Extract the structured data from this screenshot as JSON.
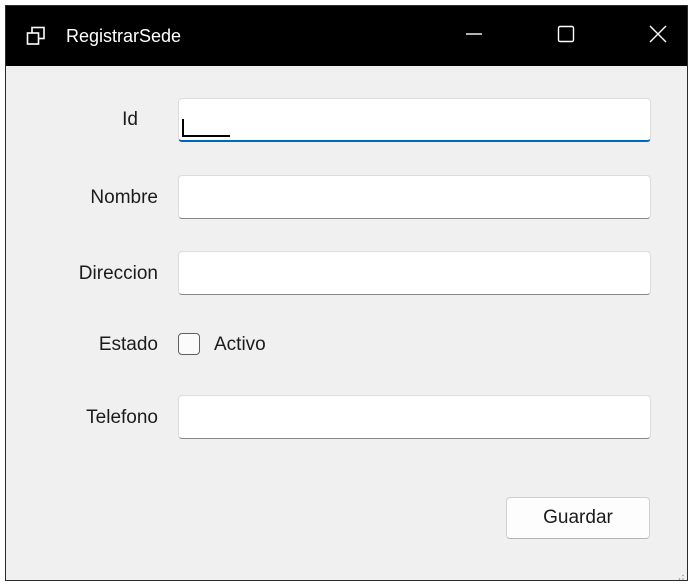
{
  "window": {
    "title": "RegistrarSede",
    "icons": {
      "app": "restore-windows-icon",
      "minimize": "minimize-icon",
      "maximize": "maximize-icon",
      "close": "close-icon"
    }
  },
  "form": {
    "id": {
      "label": "Id",
      "value": ""
    },
    "nombre": {
      "label": "Nombre",
      "value": ""
    },
    "direccion": {
      "label": "Direccion",
      "value": ""
    },
    "estado": {
      "label": "Estado",
      "checkbox_label": "Activo",
      "checked": false
    },
    "telefono": {
      "label": "Telefono",
      "value": ""
    }
  },
  "actions": {
    "save_label": "Guardar"
  },
  "colors": {
    "titlebar": "#000000",
    "window_bg": "#f0f0f0",
    "focus_accent": "#0067c0"
  }
}
